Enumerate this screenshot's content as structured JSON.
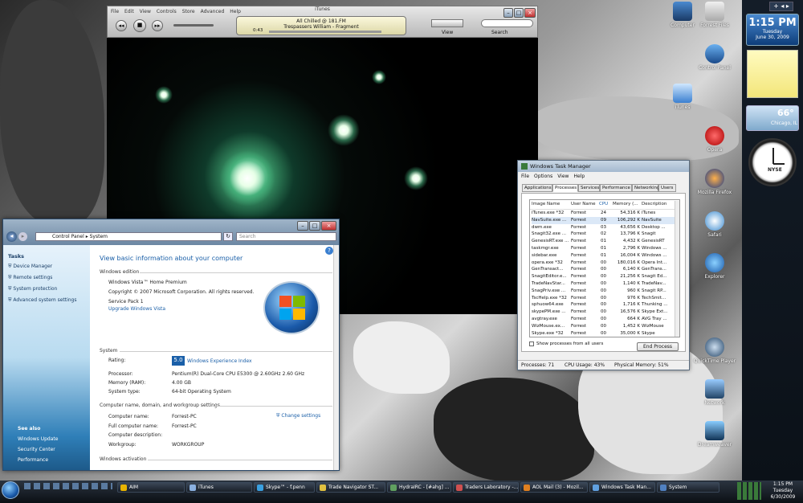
{
  "itunes": {
    "title": "iTunes",
    "menu": [
      "File",
      "Edit",
      "View",
      "Controls",
      "Store",
      "Advanced",
      "Help"
    ],
    "now_playing_album": "All Chilled @ 181.FM",
    "now_playing_track": "Trespassers William - Fragment",
    "elapsed": "0:43",
    "view_label": "View",
    "search_label": "Search"
  },
  "sys": {
    "breadcrumb_root": "Control Panel",
    "breadcrumb_page": "System",
    "search_placeholder": "Search",
    "tasks_heading": "Tasks",
    "tasks": [
      "Device Manager",
      "Remote settings",
      "System protection",
      "Advanced system settings"
    ],
    "see_also_heading": "See also",
    "see_also": [
      "Windows Update",
      "Security Center",
      "Performance"
    ],
    "heading": "View basic information about your computer",
    "edition_heading": "Windows edition",
    "edition": "Windows Vista™ Home Premium",
    "copyright": "Copyright © 2007 Microsoft Corporation.  All rights reserved.",
    "service_pack": "Service Pack 1",
    "upgrade_link": "Upgrade Windows Vista",
    "system_heading": "System",
    "rating_label": "Rating:",
    "rating_value": "5.0",
    "rating_link": "Windows Experience Index",
    "processor_label": "Processor:",
    "processor_value": "Pentium(R) Dual-Core  CPU     E5300  @ 2.60GHz   2.60 GHz",
    "memory_label": "Memory (RAM):",
    "memory_value": "4.00 GB",
    "systype_label": "System type:",
    "systype_value": "64-bit Operating System",
    "cn_heading": "Computer name, domain, and workgroup settings",
    "computer_name_label": "Computer name:",
    "computer_name_value": "Forrest-PC",
    "full_name_label": "Full computer name:",
    "full_name_value": "Forrest-PC",
    "desc_label": "Computer description:",
    "workgroup_label": "Workgroup:",
    "workgroup_value": "WORKGROUP",
    "change_settings": "Change settings",
    "activation_heading": "Windows activation"
  },
  "tm": {
    "title": "Windows Task Manager",
    "menu": [
      "File",
      "Options",
      "View",
      "Help"
    ],
    "tabs": [
      "Applications",
      "Processes",
      "Services",
      "Performance",
      "Networking",
      "Users"
    ],
    "columns": [
      "Image Name",
      "User Name",
      "CPU",
      "Memory (...",
      "Description"
    ],
    "rows": [
      [
        "iTunes.exe *32",
        "Forrest",
        "24",
        "54,316 K",
        "iTunes"
      ],
      [
        "NavSuite.exe ...",
        "Forrest",
        "09",
        "106,292 K",
        "NavSuite"
      ],
      [
        "dwm.exe",
        "Forrest",
        "03",
        "43,656 K",
        "Desktop ..."
      ],
      [
        "Snagit32.exe ...",
        "Forrest",
        "02",
        "13,796 K",
        "Snagit"
      ],
      [
        "GenesisRT.exe ...",
        "Forrest",
        "01",
        "4,432 K",
        "GenesisRT"
      ],
      [
        "taskmgr.exe",
        "Forrest",
        "01",
        "2,796 K",
        "Windows ..."
      ],
      [
        "sidebar.exe",
        "Forrest",
        "01",
        "16,004 K",
        "Windows ..."
      ],
      [
        "opera.exe *32",
        "Forrest",
        "00",
        "180,016 K",
        "Opera Int..."
      ],
      [
        "GenTransact...",
        "Forrest",
        "00",
        "6,140 K",
        "GenTrans..."
      ],
      [
        "SnagitEditor.e...",
        "Forrest",
        "00",
        "21,256 K",
        "Snagit Ed..."
      ],
      [
        "TradeNavStar...",
        "Forrest",
        "00",
        "1,140 K",
        "TradeNav..."
      ],
      [
        "SnagPriv.exe ...",
        "Forrest",
        "00",
        "960 K",
        "Snagit RP..."
      ],
      [
        "TscHelp.exe *32",
        "Forrest",
        "00",
        "976 K",
        "TechSmit..."
      ],
      [
        "sphuow64.exe",
        "Forrest",
        "00",
        "1,716 K",
        "Thunking ..."
      ],
      [
        "skypePM.exe ...",
        "Forrest",
        "00",
        "16,576 K",
        "Skype Ext..."
      ],
      [
        "avgtray.exe",
        "Forrest",
        "00",
        "664 K",
        "AVG Tray ..."
      ],
      [
        "WizMouse.ex...",
        "Forrest",
        "00",
        "1,452 K",
        "WizMouse"
      ],
      [
        "Skype.exe *32",
        "Forrest",
        "00",
        "35,000 K",
        "Skype"
      ]
    ],
    "show_all": "Show processes from all users",
    "end_process": "End Process",
    "status_processes": "Processes: 71",
    "status_cpu": "CPU Usage: 43%",
    "status_mem": "Physical Memory: 51%"
  },
  "desktop": {
    "icons": [
      "Computer",
      "Forrest Files",
      "Control Panel",
      "iTunes",
      "Opera",
      "Mozilla Firefox",
      "Safari",
      "Explorer",
      "QuickTime Player",
      "Network",
      "Dreamweaver"
    ]
  },
  "gadgets": {
    "time": "1:15 PM",
    "day": "Tuesday",
    "date": "June 30, 2009",
    "temp": "66°",
    "city": "Chicago, IL",
    "clock_label": "NYSE"
  },
  "taskbar": {
    "buttons": [
      "AIM",
      "iTunes",
      "Skype™ - f.penn",
      "Trade Navigator ST...",
      "HydraIRC - [#ahg] ...",
      "Traders Laboratory -...",
      "AOL Mail (3) - Mozil...",
      "Windows Task Man...",
      "System"
    ],
    "time": "1:15 PM",
    "day": "Tuesday",
    "date": "6/30/2009"
  },
  "colors": {
    "accent": "#1a5fa8",
    "link": "#1a3e66"
  }
}
